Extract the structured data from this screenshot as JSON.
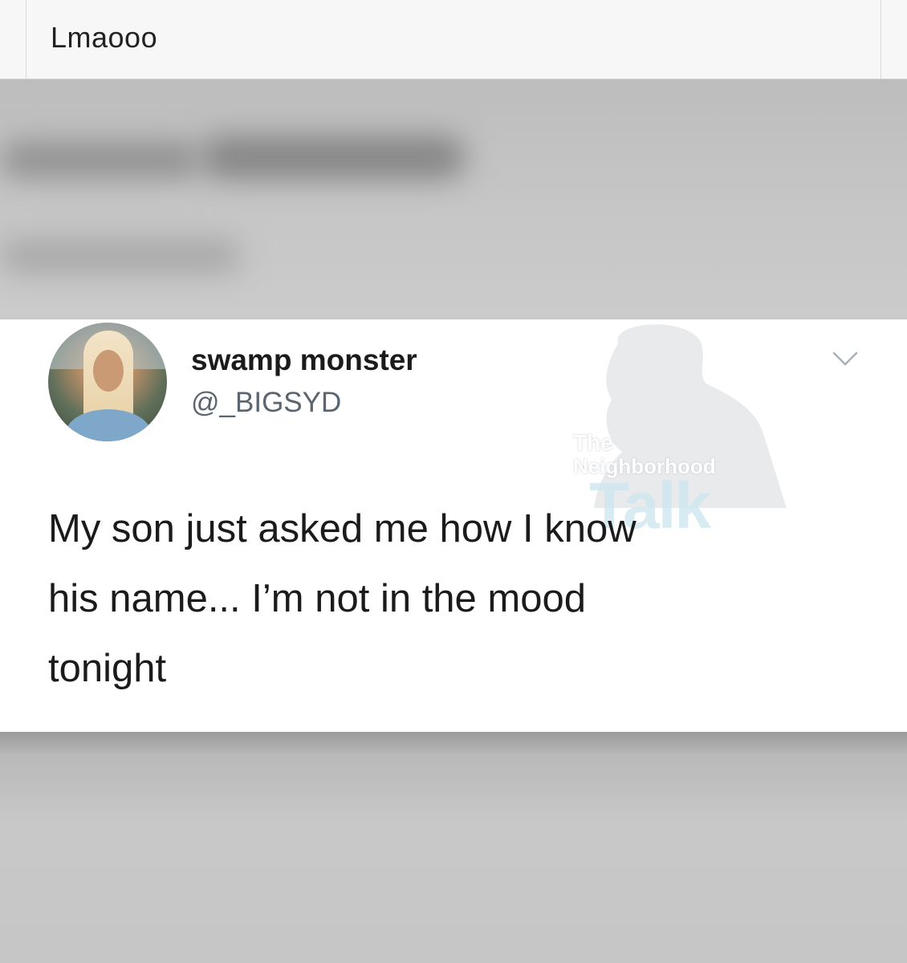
{
  "caption": {
    "text": "Lmaooo"
  },
  "tweet": {
    "display_name": "swamp monster",
    "handle": "@_BIGSYD",
    "text_lines": [
      "My son just asked me how I know",
      "his name... I’m not in the mood",
      "tonight"
    ],
    "menu_icon": "chevron-down-icon",
    "avatar_icon": "profile-photo"
  },
  "watermark": {
    "line1": "The",
    "line2": "Neighborhood",
    "line3": "Talk"
  },
  "colors": {
    "page_background": "#c4c4c4",
    "card_background": "#ffffff",
    "caption_background": "#f7f7f7",
    "primary_text": "#1b1b1b",
    "secondary_text": "#5b6570"
  }
}
